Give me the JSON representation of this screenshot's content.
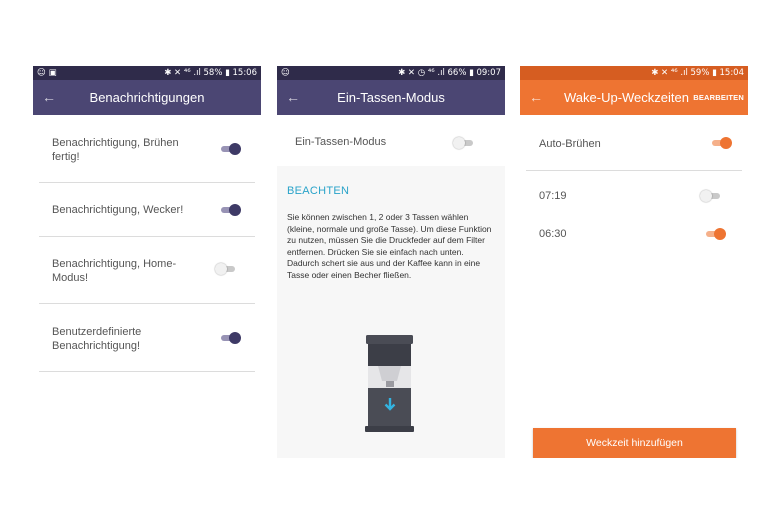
{
  "screen1": {
    "status": {
      "left": "☺ ▣",
      "right": "✱ ✕ ⁴⁶ .ıl 58% ▮ 15:06"
    },
    "back_glyph": "←",
    "title": "Benachrichtigungen",
    "items": [
      {
        "label_line1": "Benachrichtigung, Brühen",
        "label_line2": "fertig!",
        "state": "on"
      },
      {
        "label_line1": "Benachrichtigung, Wecker!",
        "label_line2": "",
        "state": "on"
      },
      {
        "label_line1": "Benachrichtigung, Home-",
        "label_line2": "Modus!",
        "state": "off"
      },
      {
        "label_line1": "Benutzerdefinierte",
        "label_line2": "Benachrichtigung!",
        "state": "on"
      }
    ]
  },
  "screen2": {
    "status": {
      "left": "☺",
      "right": "✱ ✕ ◷ ⁴⁶ .ıl 66% ▮ 09:07"
    },
    "back_glyph": "←",
    "title": "Ein-Tassen-Modus",
    "toggle_label": "Ein-Tassen-Modus",
    "toggle_state": "off",
    "heading": "BEACHTEN",
    "paragraph": "Sie können zwischen 1, 2 oder 3 Tassen wählen (kleine, normale und große Tasse). Um diese Funktion zu nutzen, müssen Sie die Druckfeder auf dem Filter entfernen. Drücken Sie sie einfach nach unten. Dadurch schert sie aus und der Kaffee kann in eine Tasse oder einen Becher fließen."
  },
  "screen3": {
    "status": {
      "left": "",
      "right": "✱ ✕ ⁴⁶ .ıl 59% ▮ 15:04"
    },
    "back_glyph": "←",
    "title": "Wake-Up-Weckzeiten",
    "edit_label": "BEARBEITEN",
    "auto_label": "Auto-Brühen",
    "auto_state": "on",
    "alarms": [
      {
        "time": "07:19",
        "state": "off"
      },
      {
        "time": "06:30",
        "state": "on"
      }
    ],
    "add_button": "Weckzeit hinzufügen"
  },
  "colors": {
    "purple_statusbar": "#2f2b4a",
    "purple_appbar": "#4b4673",
    "purple_toggle": "#3e3a66",
    "orange_statusbar": "#d65d21",
    "orange_accent": "#ee7432",
    "heading_blue": "#29a3c9"
  },
  "icons": [
    "back-arrow-icon",
    "bluetooth-icon",
    "mute-icon",
    "signal-icon",
    "battery-icon",
    "coffee-machine-icon",
    "down-arrow-icon"
  ]
}
